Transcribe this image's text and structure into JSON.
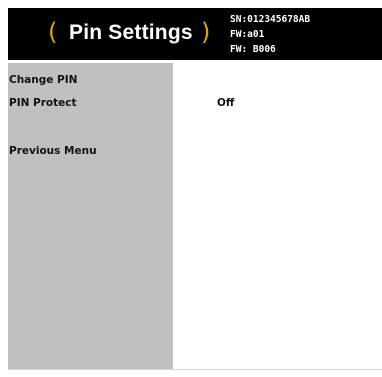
{
  "header": {
    "title": "Pin Settings",
    "bracket_left": "(",
    "bracket_right": ")",
    "serial": "SN:012345678AB",
    "firmware_1": "FW:a01",
    "firmware_2": "FW: B006"
  },
  "menu": {
    "items": [
      {
        "label": "Change PIN",
        "value": ""
      },
      {
        "label": "PIN Protect",
        "value": "Off"
      },
      {
        "label": "Previous Menu",
        "value": ""
      }
    ]
  },
  "colors": {
    "header_bg": "#000000",
    "bracket": "#e0a400",
    "sidebar_bg": "#c0c0c0",
    "content_bg": "#ffffff"
  }
}
